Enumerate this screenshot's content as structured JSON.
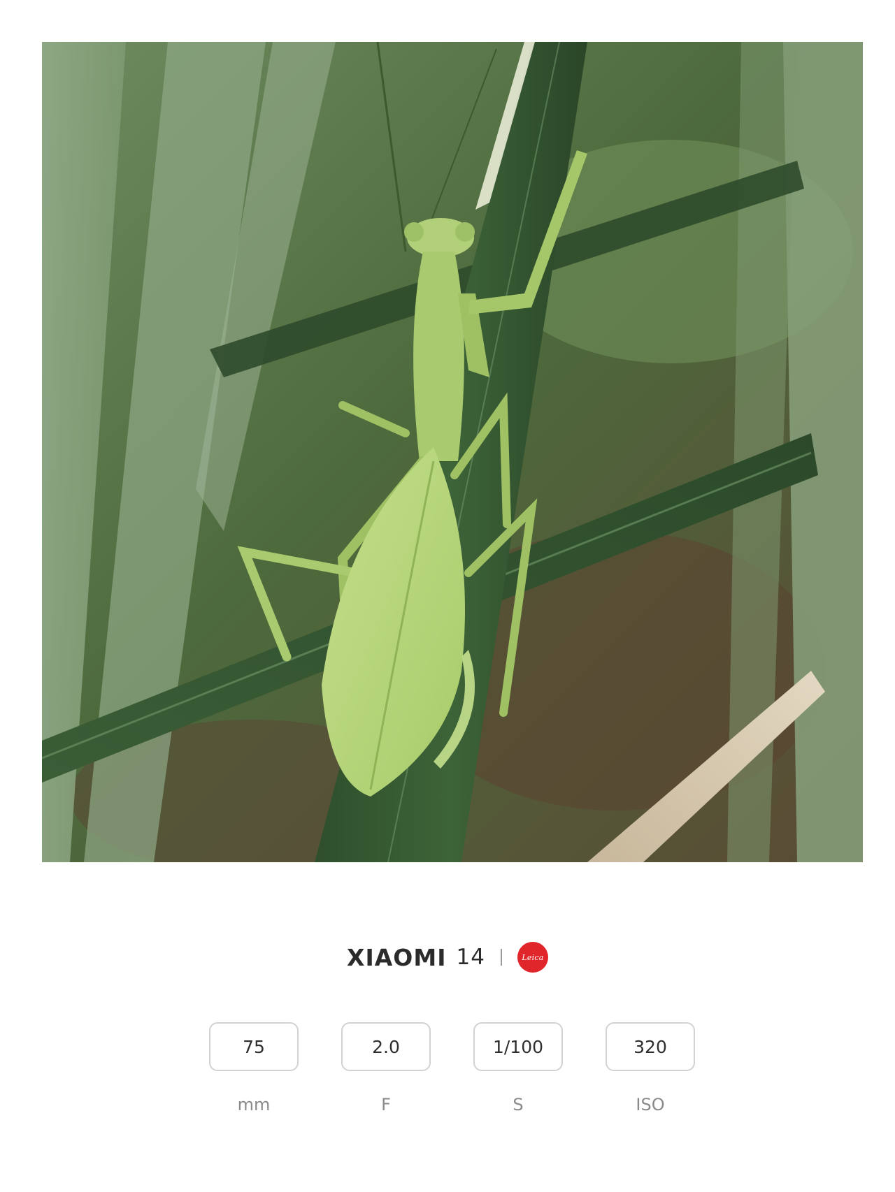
{
  "photo": {
    "subject_icon": "praying-mantis-photo"
  },
  "brand": {
    "name": "XIAOMI",
    "model": "14",
    "logo_text": "Leica",
    "logo_color": "#e0262b"
  },
  "exif": {
    "items": [
      {
        "value": "75",
        "label": "mm"
      },
      {
        "value": "2.0",
        "label": "F"
      },
      {
        "value": "1/100",
        "label": "S"
      },
      {
        "value": "320",
        "label": "ISO"
      }
    ]
  }
}
